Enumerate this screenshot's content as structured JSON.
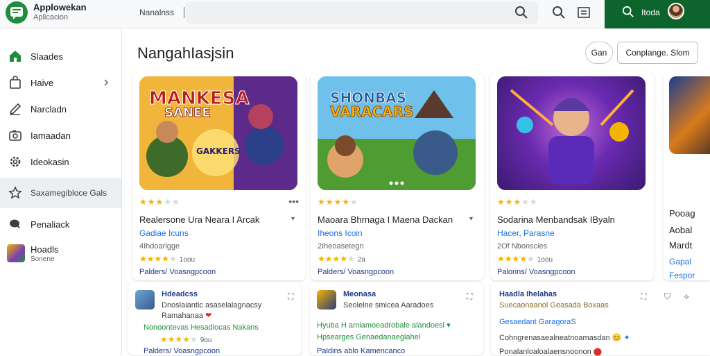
{
  "app": {
    "title": "Applowekan",
    "subtitle": "Aplicacion"
  },
  "topbar": {
    "label": "Nanalnss",
    "search_placeholder": "",
    "user_name": "Itoda"
  },
  "sidebar": {
    "items": [
      {
        "label": "Slaades",
        "icon": "home-icon"
      },
      {
        "label": "Haive",
        "icon": "bag-icon"
      },
      {
        "label": "Narcladn",
        "icon": "pencil-icon"
      },
      {
        "label": "Iamaadan",
        "icon": "camera-icon"
      },
      {
        "label": "Ideokasin",
        "icon": "gear-icon"
      },
      {
        "label": "Saxamegibloce Gals",
        "icon": "star-outline-icon"
      },
      {
        "label": "Penaliack",
        "icon": "chat-icon"
      },
      {
        "label": "Hoadls",
        "sub": "Sonene",
        "icon": "app-thumb"
      }
    ]
  },
  "main": {
    "title": "NangahIasjsin",
    "btn_small": "Gan",
    "btn_primary": "Conplange. Slom"
  },
  "cards": [
    {
      "art_title": "MANKESA",
      "art_sub": "SANEE",
      "art_badge": "GAKKERS",
      "stars": 3,
      "title": "Realersone Ura Neara I Arcak",
      "dev": "Gadiae Icuns",
      "downloads": "4Ihdoarlgge",
      "rating_count": "1oou",
      "link": "Palders/ Voasngpcoon"
    },
    {
      "art_title": "SHONBAS",
      "art_sub": "VARACARS",
      "stars": 4,
      "title": "Maoara Bhrnaga I Maena Dackan",
      "dev": "Iheons Icoin",
      "downloads": "2Iheoasetegn",
      "rating_count": "2a",
      "link": "Palders/ Voasngpcoon"
    },
    {
      "stars": 3,
      "title": "Sodarina Menbandsak IByaln",
      "dev": "Hacer, Parasne",
      "downloads": "2Of Nbonscies",
      "rating_count": "1oou",
      "link": "Palorins/ Voasngpcoon"
    }
  ],
  "partial_card": {
    "l1": "Pooag",
    "l2": "Aobal",
    "l3": "Mardt",
    "dev": "Gapal",
    "dev2": "Fespor"
  },
  "mini": [
    {
      "title": "Hdeadcss",
      "l1": "Dnoslaiantic asaselalagnacsy",
      "l2": "Ramahanaa",
      "l3": "Nonoontevas Hesadlocas Nakans",
      "link": "Palders/ Voasngpcoon",
      "rating_count": "9ou"
    },
    {
      "title": "Meonasa",
      "l1": "Seolelne smicea Aaradoes",
      "l2": "Hyuba H amiamoeadrobale alandoesl",
      "l3": "Hpsearges Genaedanaeglahel",
      "link": "Paldins ablo Kamencanco"
    },
    {
      "title": "Haadla Ihelahas",
      "l1": "Suecaonaanol Geasada Boxaas",
      "l2": "Gesaedant GaragoraS",
      "l3": "Cohngrenasaealneatnoamasdan",
      "link": "Ponalanloaloalaensnoonon"
    }
  ]
}
